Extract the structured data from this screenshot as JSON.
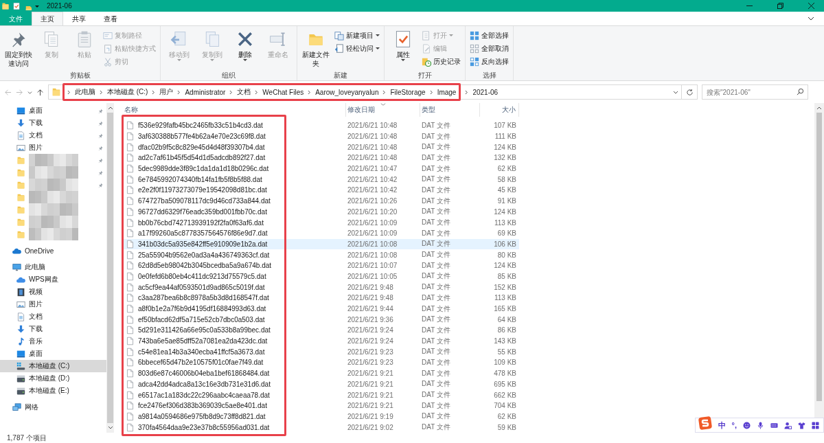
{
  "window": {
    "title": "2021-06"
  },
  "ribbon": {
    "tabs": [
      {
        "label": "文件",
        "kind": "file",
        "selected": false
      },
      {
        "label": "主页",
        "kind": "tab",
        "selected": true
      },
      {
        "label": "共享",
        "kind": "tab",
        "selected": false
      },
      {
        "label": "查看",
        "kind": "tab",
        "selected": false
      }
    ],
    "groups": [
      {
        "label": "剪贴板",
        "buttons": [
          {
            "label": "固定到快速访问",
            "kind": "pin",
            "large": true,
            "disabled": false,
            "dropdown": false
          },
          {
            "label": "复制",
            "kind": "copy",
            "large": true,
            "disabled": true,
            "dropdown": false
          },
          {
            "label": "粘贴",
            "kind": "paste",
            "large": true,
            "disabled": true,
            "dropdown": false
          },
          {
            "label": "复制路径",
            "kind": "copypath",
            "large": false,
            "disabled": true,
            "dropdown": false
          },
          {
            "label": "粘贴快捷方式",
            "kind": "shortcut",
            "large": false,
            "disabled": true,
            "dropdown": false
          },
          {
            "label": "剪切",
            "kind": "cut",
            "large": false,
            "disabled": true,
            "dropdown": false
          }
        ]
      },
      {
        "label": "组织",
        "buttons": [
          {
            "label": "移动到",
            "kind": "move",
            "large": true,
            "disabled": true,
            "dropdown": true
          },
          {
            "label": "复制到",
            "kind": "copyto",
            "large": true,
            "disabled": true,
            "dropdown": true
          },
          {
            "label": "删除",
            "kind": "delete",
            "large": true,
            "disabled": false,
            "dropdown": true
          },
          {
            "label": "重命名",
            "kind": "rename",
            "large": true,
            "disabled": true,
            "dropdown": false
          }
        ]
      },
      {
        "label": "新建",
        "buttons": [
          {
            "label": "新建文件夹",
            "kind": "newfolder",
            "large": true,
            "disabled": false,
            "dropdown": false
          },
          {
            "label": "新建项目",
            "kind": "newitem",
            "large": false,
            "disabled": false,
            "dropdown": true
          },
          {
            "label": "轻松访问",
            "kind": "easyaccess",
            "large": false,
            "disabled": false,
            "dropdown": true
          }
        ]
      },
      {
        "label": "打开",
        "buttons": [
          {
            "label": "属性",
            "kind": "properties",
            "large": true,
            "disabled": false,
            "dropdown": true
          },
          {
            "label": "打开",
            "kind": "open",
            "large": false,
            "disabled": true,
            "dropdown": true
          },
          {
            "label": "编辑",
            "kind": "edit",
            "large": false,
            "disabled": true,
            "dropdown": false
          },
          {
            "label": "历史记录",
            "kind": "history",
            "large": false,
            "disabled": false,
            "dropdown": false
          }
        ]
      },
      {
        "label": "选择",
        "buttons": [
          {
            "label": "全部选择",
            "kind": "selectall",
            "large": false,
            "disabled": false,
            "dropdown": false
          },
          {
            "label": "全部取消",
            "kind": "selectnone",
            "large": false,
            "disabled": false,
            "dropdown": false
          },
          {
            "label": "反向选择",
            "kind": "invert",
            "large": false,
            "disabled": false,
            "dropdown": false
          }
        ]
      }
    ]
  },
  "address_bar": {
    "back_disabled": true,
    "forward_disabled": true,
    "path_highlighted": true,
    "breadcrumbs": [
      "此电脑",
      "本地磁盘 (C:)",
      "用户",
      "Administrator",
      "文档",
      "WeChat Files",
      "Aarow_loveyanyalun",
      "FileStorage",
      "Image"
    ],
    "current_folder": "2021-06",
    "search": {
      "placeholder": "搜索\"2021-06\""
    }
  },
  "navigation": {
    "quick_access": [
      {
        "label": "桌面",
        "kind": "desktop",
        "pinned": true
      },
      {
        "label": "下载",
        "kind": "download",
        "pinned": true
      },
      {
        "label": "文档",
        "kind": "document",
        "pinned": true
      },
      {
        "label": "图片",
        "kind": "picture",
        "pinned": true
      },
      {
        "kind": "redacted",
        "pinned": true
      },
      {
        "kind": "redacted",
        "pinned": true
      },
      {
        "kind": "redacted",
        "pinned": true
      },
      {
        "kind": "redacted",
        "pinned": false
      },
      {
        "kind": "redacted",
        "pinned": false
      },
      {
        "kind": "redacted",
        "pinned": false
      },
      {
        "kind": "redacted",
        "pinned": false
      }
    ],
    "onedrive": {
      "label": "OneDrive"
    },
    "this_pc": {
      "label": "此电脑",
      "children": [
        {
          "label": "WPS网盘",
          "kind": "cloud",
          "selected": false
        },
        {
          "label": "视频",
          "kind": "video",
          "selected": false
        },
        {
          "label": "图片",
          "kind": "picture",
          "selected": false
        },
        {
          "label": "文档",
          "kind": "document",
          "selected": false
        },
        {
          "label": "下载",
          "kind": "download",
          "selected": false
        },
        {
          "label": "音乐",
          "kind": "music",
          "selected": false
        },
        {
          "label": "桌面",
          "kind": "desktop",
          "selected": false
        },
        {
          "label": "本地磁盘 (C:)",
          "kind": "systemdrive",
          "selected": true
        },
        {
          "label": "本地磁盘 (D:)",
          "kind": "drive",
          "selected": false
        },
        {
          "label": "本地磁盘 (E:)",
          "kind": "drive",
          "selected": false
        }
      ]
    },
    "network": {
      "label": "网络"
    }
  },
  "file_list": {
    "name_column_highlighted": true,
    "columns": [
      {
        "label": "名称",
        "sorted": false
      },
      {
        "label": "修改日期",
        "sorted": true
      },
      {
        "label": "类型",
        "sorted": false
      },
      {
        "label": "大小",
        "sorted": false
      }
    ],
    "rows": [
      {
        "name": "f536e929fafb45bc2465fb33c51b4cd3.dat",
        "date": "2021/6/21 10:48",
        "type": "DAT 文件",
        "size": "107 KB",
        "selected": false
      },
      {
        "name": "3af630388b577fe4b62a4e70e23c69f8.dat",
        "date": "2021/6/21 10:48",
        "type": "DAT 文件",
        "size": "111 KB",
        "selected": false
      },
      {
        "name": "dfac02b9f5c8c829e45d4d48f39307b4.dat",
        "date": "2021/6/21 10:48",
        "type": "DAT 文件",
        "size": "124 KB",
        "selected": false
      },
      {
        "name": "ad2c7af61b45f5d54d1d5adcdb892f27.dat",
        "date": "2021/6/21 10:48",
        "type": "DAT 文件",
        "size": "132 KB",
        "selected": false
      },
      {
        "name": "5dec9989dde3f89c1da1da1d18b0296c.dat",
        "date": "2021/6/21 10:47",
        "type": "DAT 文件",
        "size": "62 KB",
        "selected": false
      },
      {
        "name": "6e7845992074340fb14fa1fb5f8b5f88.dat",
        "date": "2021/6/21 10:42",
        "type": "DAT 文件",
        "size": "58 KB",
        "selected": false
      },
      {
        "name": "e2e2f0f11973273079e19542098d81bc.dat",
        "date": "2021/6/21 10:42",
        "type": "DAT 文件",
        "size": "45 KB",
        "selected": false
      },
      {
        "name": "674727ba509078117dc9d46cd733a844.dat",
        "date": "2021/6/21 10:26",
        "type": "DAT 文件",
        "size": "91 KB",
        "selected": false
      },
      {
        "name": "96727dd6329f76eadc359bd001fbb70c.dat",
        "date": "2021/6/21 10:20",
        "type": "DAT 文件",
        "size": "124 KB",
        "selected": false
      },
      {
        "name": "bb0b76cbd742713939192f2fa0f63af6.dat",
        "date": "2021/6/21 10:09",
        "type": "DAT 文件",
        "size": "113 KB",
        "selected": false
      },
      {
        "name": "a17f99260a5c8778357564576f86e9d7.dat",
        "date": "2021/6/21 10:09",
        "type": "DAT 文件",
        "size": "69 KB",
        "selected": false
      },
      {
        "name": "341b03dc5a935e842ff5e910909e1b2a.dat",
        "date": "2021/6/21 10:08",
        "type": "DAT 文件",
        "size": "106 KB",
        "selected": true
      },
      {
        "name": "25a55904b9562e0ad3a4a436749363cf.dat",
        "date": "2021/6/21 10:08",
        "type": "DAT 文件",
        "size": "80 KB",
        "selected": false
      },
      {
        "name": "62d8d5eb98042b3045bcedba5a9a674b.dat",
        "date": "2021/6/21 10:07",
        "type": "DAT 文件",
        "size": "124 KB",
        "selected": false
      },
      {
        "name": "0e0fefd6b80eb4c411dc9213d75579c5.dat",
        "date": "2021/6/21 10:05",
        "type": "DAT 文件",
        "size": "85 KB",
        "selected": false
      },
      {
        "name": "ac5cf9ea44af0593501d9ad865c5019f.dat",
        "date": "2021/6/21 9:48",
        "type": "DAT 文件",
        "size": "152 KB",
        "selected": false
      },
      {
        "name": "c3aa287bea6b8c8978a5b3d8d168547f.dat",
        "date": "2021/6/21 9:48",
        "type": "DAT 文件",
        "size": "113 KB",
        "selected": false
      },
      {
        "name": "a8f0b1e2a7f6b9d4195df16884993d63.dat",
        "date": "2021/6/21 9:44",
        "type": "DAT 文件",
        "size": "165 KB",
        "selected": false
      },
      {
        "name": "ef50bfacd62df5a715e52cb7dbc0a503.dat",
        "date": "2021/6/21 9:36",
        "type": "DAT 文件",
        "size": "64 KB",
        "selected": false
      },
      {
        "name": "5d291e311426a66e95c0a533b8a99bec.dat",
        "date": "2021/6/21 9:24",
        "type": "DAT 文件",
        "size": "86 KB",
        "selected": false
      },
      {
        "name": "743ba6e5ae85dff52a7081ea2da423dc.dat",
        "date": "2021/6/21 9:24",
        "type": "DAT 文件",
        "size": "143 KB",
        "selected": false
      },
      {
        "name": "c54e81ea14b3a340ecba41ffcf5a3673.dat",
        "date": "2021/6/21 9:23",
        "type": "DAT 文件",
        "size": "55 KB",
        "selected": false
      },
      {
        "name": "6bbecef65d47b2e10575f01c0fae7f49.dat",
        "date": "2021/6/21 9:23",
        "type": "DAT 文件",
        "size": "109 KB",
        "selected": false
      },
      {
        "name": "803d6e87c46006b04eba1bef61868484.dat",
        "date": "2021/6/21 9:21",
        "type": "DAT 文件",
        "size": "478 KB",
        "selected": false
      },
      {
        "name": "adca42dd4adca8a13c16e3db731e31d6.dat",
        "date": "2021/6/21 9:21",
        "type": "DAT 文件",
        "size": "695 KB",
        "selected": false
      },
      {
        "name": "e6517ac1a183dc22c296aabc4caeaa78.dat",
        "date": "2021/6/21 9:21",
        "type": "DAT 文件",
        "size": "662 KB",
        "selected": false
      },
      {
        "name": "fce2476ef306d383b369039c5ae8e401.dat",
        "date": "2021/6/21 9:21",
        "type": "DAT 文件",
        "size": "704 KB",
        "selected": false
      },
      {
        "name": "a9814a0594686e975fb8d9c73ff8d821.dat",
        "date": "2021/6/21 9:19",
        "type": "DAT 文件",
        "size": "62 KB",
        "selected": false
      },
      {
        "name": "370fa4564daa9e23e37b8c55956ad031.dat",
        "date": "2021/6/21 9:02",
        "type": "DAT 文件",
        "size": "59 KB",
        "selected": false
      }
    ]
  },
  "status_bar": {
    "item_count": "1,787 个项目"
  },
  "ime_toolbar": {
    "labels": [
      "中",
      "°,"
    ]
  }
}
